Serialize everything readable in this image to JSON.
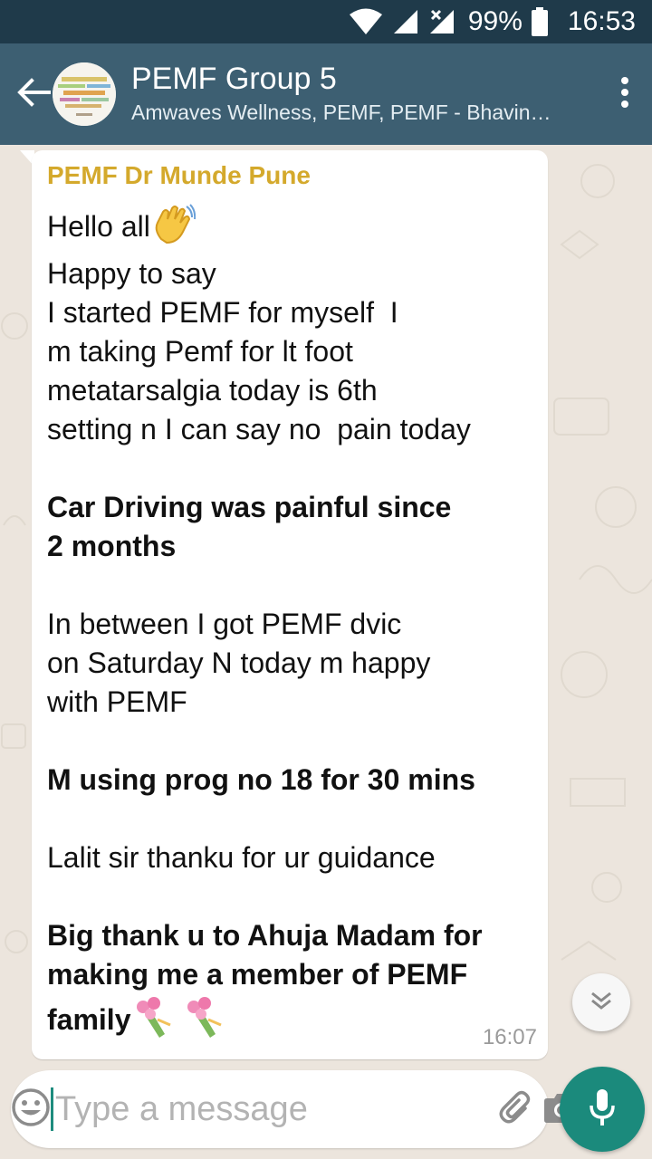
{
  "status_bar": {
    "battery": "99%",
    "time": "16:53",
    "icons": [
      "wifi-icon",
      "signal-icon",
      "signal-no-data-icon",
      "battery-icon"
    ]
  },
  "header": {
    "title": "PEMF Group 5",
    "subtitle": "Amwaves Wellness, PEMF, PEMF - Bhavin…",
    "back_icon": "arrow-left-icon",
    "menu_icon": "more-vertical-icon",
    "avatar_text": "P.E.M.F."
  },
  "message": {
    "sender": "PEMF Dr Munde Pune",
    "lines": [
      {
        "text": "Hello all",
        "bold": false,
        "emoji": "👋"
      },
      {
        "text": "Happy to say",
        "bold": false
      },
      {
        "text": "I started PEMF for myself  I",
        "bold": false
      },
      {
        "text": "m taking Pemf for lt foot",
        "bold": false
      },
      {
        "text": "metatarsalgia today is 6th",
        "bold": false
      },
      {
        "text": "setting n I can say no  pain today",
        "bold": false
      },
      {
        "text": "",
        "bold": false
      },
      {
        "text": "Car Driving was painful since",
        "bold": true
      },
      {
        "text": "2 months",
        "bold": true
      },
      {
        "text": "",
        "bold": false
      },
      {
        "text": "In between I got PEMF dvic",
        "bold": false
      },
      {
        "text": "on Saturday N today m happy",
        "bold": false
      },
      {
        "text": "with PEMF",
        "bold": false
      },
      {
        "text": "",
        "bold": false
      },
      {
        "text": "M using prog no 18 for 30 mins",
        "bold": true
      },
      {
        "text": "",
        "bold": false
      },
      {
        "text": "Lalit sir thanku for ur guidance",
        "bold": false
      },
      {
        "text": "",
        "bold": false
      },
      {
        "text": "Big thank u to Ahuja Madam for",
        "bold": true
      },
      {
        "text": "making me a member of PEMF",
        "bold": true
      },
      {
        "text": "family",
        "bold": true,
        "emoji": "💐 💐"
      }
    ],
    "time": "16:07"
  },
  "composer": {
    "placeholder": "Type a message",
    "value": ""
  },
  "colors": {
    "status_bar": "#1f3a4a",
    "header": "#3d5f72",
    "sender_name": "#d4a92c",
    "mic_button": "#1b8a7c",
    "wallpaper": "#ece5dd"
  }
}
